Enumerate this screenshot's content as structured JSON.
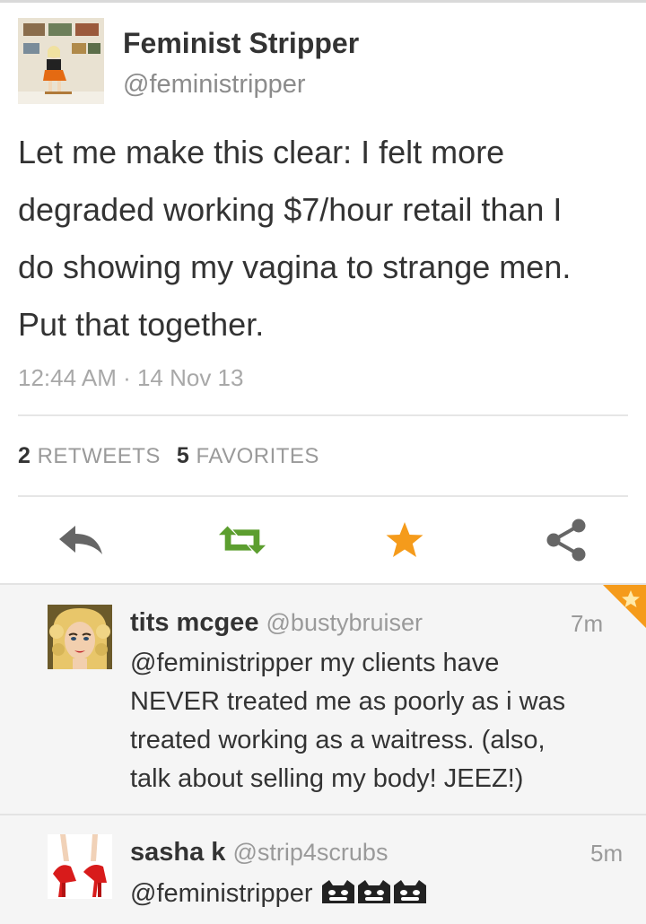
{
  "tweet": {
    "author_name": "Feminist Stripper",
    "author_handle": "@feministripper",
    "text_lines": [
      "Let me make this clear: I felt more",
      "degraded working $7/hour retail than I",
      "do showing my vagina to strange men.",
      "Put that together."
    ],
    "timestamp": "12:44 AM · 14 Nov 13",
    "retweet_count": "2",
    "retweet_label": "RETWEETS",
    "favorite_count": "5",
    "favorite_label": "FAVORITES"
  },
  "actions": [
    {
      "name": "reply",
      "icon": "reply-arrow-icon"
    },
    {
      "name": "retweet",
      "icon": "retweet-icon"
    },
    {
      "name": "favorite",
      "icon": "star-icon"
    },
    {
      "name": "share",
      "icon": "share-icon"
    }
  ],
  "replies": [
    {
      "name": "tits mcgee",
      "handle": "@bustybruiser",
      "age": "7m",
      "text_lines": [
        "@feministripper my clients have",
        "NEVER treated me as poorly as i was",
        "treated working as a waitress. (also,",
        "talk about selling my body! JEEZ!)"
      ]
    },
    {
      "name": "sasha k",
      "handle": "@strip4scrubs",
      "age": "5m",
      "text": "@feministripper"
    }
  ],
  "colors": {
    "retweet_green": "#5c9e2f",
    "favorite_orange": "#f59b1b",
    "icon_gray": "#666666"
  }
}
